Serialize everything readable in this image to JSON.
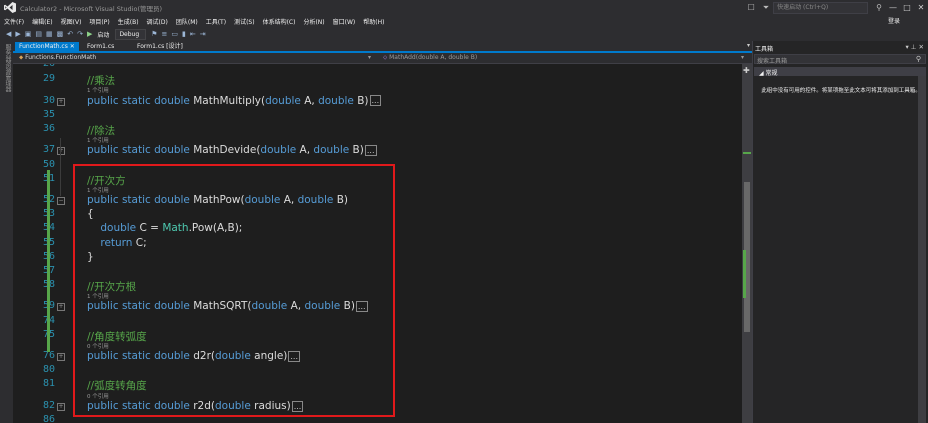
{
  "window": {
    "title": "Calculator2 - Microsoft Visual Studio(管理员)",
    "quick_launch_placeholder": "快速启动 (Ctrl+Q)",
    "login": "登录"
  },
  "menu": [
    "文件(F)",
    "编辑(E)",
    "视图(V)",
    "项目(P)",
    "生成(B)",
    "调试(D)",
    "团队(M)",
    "工具(T)",
    "测试(S)",
    "体系结构(C)",
    "分析(N)",
    "窗口(W)",
    "帮助(H)"
  ],
  "toolbar": {
    "start_label": "启动",
    "config": "Debug"
  },
  "left_strip_label": "服务器资源管理器",
  "tabs": [
    {
      "label": "FunctionMath.cs",
      "active": true
    },
    {
      "label": "Form1.cs"
    },
    {
      "label": "Form1.cs [设计]"
    }
  ],
  "navbar": {
    "class_path": "Functions.FunctionMath",
    "member": "MathAdd(double A, double B)"
  },
  "editor": {
    "top_line": "26",
    "lines": [
      {
        "n": "29",
        "kind": "comment",
        "text": "//乘法"
      },
      {
        "n": "30",
        "kind": "method",
        "refs": "1 个引用",
        "sig": "MathMultiply",
        "params": "(double A, double B)",
        "collapsed": true,
        "fold": "+"
      },
      {
        "n": "35",
        "kind": "blank"
      },
      {
        "n": "36",
        "kind": "comment",
        "text": "//除法"
      },
      {
        "n": "37",
        "kind": "method",
        "refs": "1 个引用",
        "sig": "MathDevide",
        "params": "(double A, double B)",
        "collapsed": true,
        "fold": "+"
      },
      {
        "n": "50",
        "kind": "blank"
      },
      {
        "n": "51",
        "kind": "comment",
        "text": "//开次方"
      },
      {
        "n": "52",
        "kind": "method",
        "refs": "1 个引用",
        "sig": "MathPow",
        "params": "(double A, double B)",
        "collapsed": false,
        "fold": "−"
      },
      {
        "n": "53",
        "kind": "text",
        "text": "{"
      },
      {
        "n": "54",
        "kind": "code",
        "text": "    double C = Math.Pow(A,B);"
      },
      {
        "n": "55",
        "kind": "code",
        "text": "    return C;"
      },
      {
        "n": "56",
        "kind": "text",
        "text": "}"
      },
      {
        "n": "57",
        "kind": "blank"
      },
      {
        "n": "58",
        "kind": "comment",
        "text": "//开次方根"
      },
      {
        "n": "59",
        "kind": "method",
        "refs": "1 个引用",
        "sig": "MathSQRT",
        "params": "(double A, double B)",
        "collapsed": true,
        "fold": "+"
      },
      {
        "n": "74",
        "kind": "blank"
      },
      {
        "n": "75",
        "kind": "comment",
        "text": "//角度转弧度"
      },
      {
        "n": "76",
        "kind": "method",
        "refs": "0 个引用",
        "sig": "d2r",
        "params": "(double angle)",
        "collapsed": true,
        "fold": "+"
      },
      {
        "n": "80",
        "kind": "blank"
      },
      {
        "n": "81",
        "kind": "comment",
        "text": "//弧度转角度"
      },
      {
        "n": "82",
        "kind": "method",
        "refs": "0 个引用",
        "sig": "r2d",
        "params": "(double radius)",
        "collapsed": true,
        "fold": "+"
      },
      {
        "n": "86",
        "kind": "blank"
      }
    ],
    "keywords": {
      "public": "public",
      "static": "static",
      "double": "double",
      "return": "return"
    },
    "class_name": "Math",
    "collapsed_marker": "..."
  },
  "toolbox": {
    "title": "工具箱",
    "search_placeholder": "搜索工具箱",
    "group": "常规",
    "empty_message": "此组中没有可用的控件。将某项拖至此文本可将其添加到工具箱。"
  },
  "colors": {
    "accent": "#007acc",
    "comment": "#57a64a",
    "keyword": "#569cd6",
    "type": "#4ec9b0",
    "line_number": "#2b91af",
    "highlight_box": "#e0191b"
  }
}
